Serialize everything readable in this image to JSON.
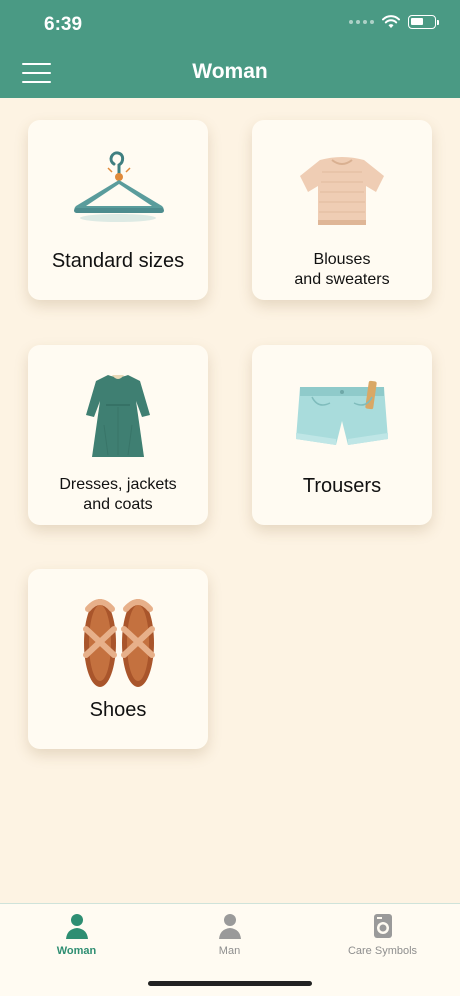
{
  "status_bar": {
    "time": "6:39"
  },
  "header": {
    "title": "Woman"
  },
  "categories": [
    {
      "label": "Standard sizes",
      "icon": "hanger-icon"
    },
    {
      "line1": "Blouses",
      "line2": "and sweaters",
      "icon": "sweater-icon"
    },
    {
      "line1": "Dresses, jackets",
      "line2": "and coats",
      "icon": "dress-icon"
    },
    {
      "label": "Trousers",
      "icon": "shorts-icon"
    },
    {
      "label": "Shoes",
      "icon": "sandals-icon"
    }
  ],
  "tabs": [
    {
      "label": "Woman",
      "icon": "woman-icon",
      "active": true
    },
    {
      "label": "Man",
      "icon": "man-icon",
      "active": false
    },
    {
      "label": "Care Symbols",
      "icon": "washing-machine-icon",
      "active": false
    }
  ],
  "colors": {
    "header": "#4a9a84",
    "background": "#fdf3e3",
    "card": "#fffbf2",
    "active_tab": "#2e8e72",
    "inactive_tab": "#8e8e8e"
  }
}
